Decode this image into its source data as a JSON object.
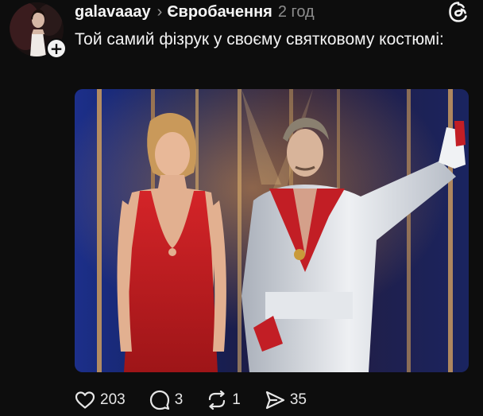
{
  "post": {
    "username": "galavaaay",
    "community": "Євробачення",
    "time": "2 год",
    "text": "Той самий фізрук у своєму святковому костюмі:",
    "follow_symbol": "+",
    "chevron": "›"
  },
  "actions": {
    "likes": "203",
    "comments": "3",
    "reposts": "1",
    "shares": "35"
  },
  "icons": {
    "like": "heart-icon",
    "comment": "comment-bubble-icon",
    "repost": "repost-icon",
    "share": "send-icon",
    "logo": "threads-logo-icon",
    "follow": "plus-icon"
  },
  "colors": {
    "background": "#0d0d0d",
    "text": "#f2f2f2",
    "muted": "#8d8d8d",
    "dress": "#c81e23",
    "suit": "#d9dde2"
  }
}
